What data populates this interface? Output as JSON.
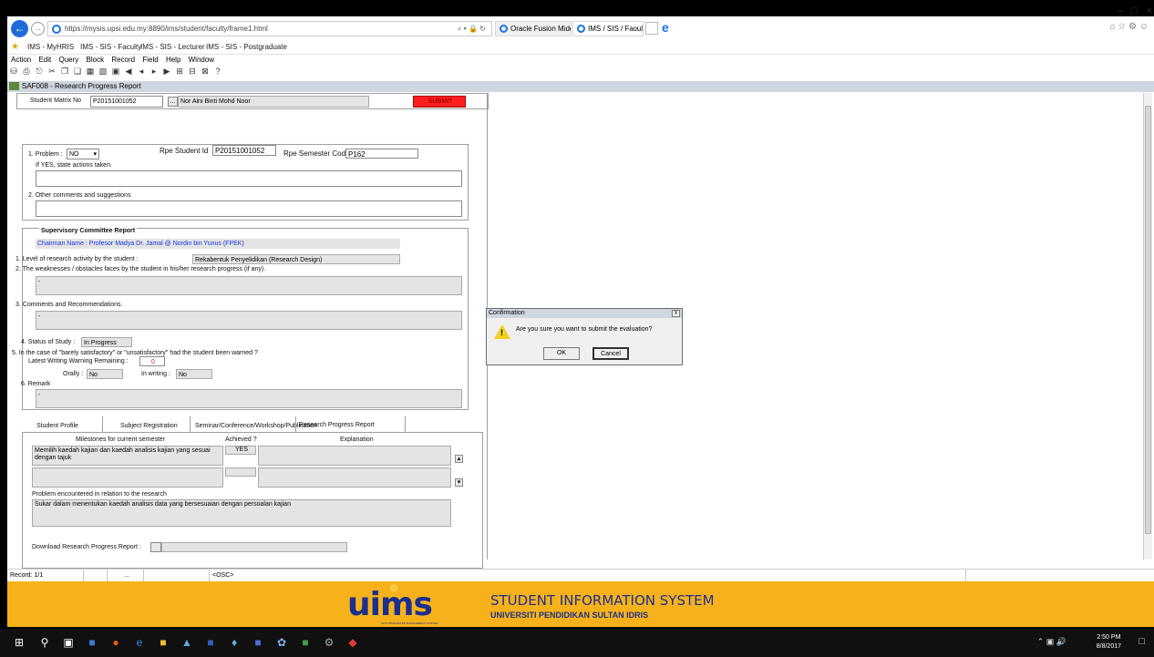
{
  "browser": {
    "url": "https://mysis.upsi.edu.my:8890/ims/student/faculty/frame1.html",
    "url_controls": "⌕ ▾ 🔒 ↻",
    "tabs": [
      {
        "label": "Oracle Fusion Middleware For..."
      },
      {
        "label": "IMS / SIS / Faculty"
      }
    ],
    "tab_close": "×",
    "favorites": [
      "IMS - MyHRIS",
      "IMS - SIS - Faculty",
      "IMS - SIS - Lecturer",
      "IMS - SIS - Postgraduate"
    ],
    "win_min": "–",
    "win_max": "□",
    "win_close": "×"
  },
  "menu": [
    "Action",
    "Edit",
    "Query",
    "Block",
    "Record",
    "Field",
    "Help",
    "Window"
  ],
  "form": {
    "title": "SAF008 - Research Progress Report",
    "student_matrix_label": "Student Matrix No",
    "student_matrix_value": "P20151001052",
    "student_name": "Nor Aini Binti Mohd Noor",
    "submit_label": "SUBMIT",
    "lov_button": "...",
    "problem_label": "1. Problem :",
    "problem_value": "NO",
    "rpe_student_id_label": "Rpe Student Id",
    "rpe_student_id_value": "P20151001052",
    "rpe_semester_label": "Rpe Semester Code",
    "rpe_semester_value": "P162",
    "if_yes_label": "If YES, state actions taken.",
    "other_comments_label": "2. Other comments and suggestions",
    "committee_title": "Supervisory Committee Report",
    "chairman": "Chairman Name : Profesor Madya Dr. Jamal @ Nordin bin Yunus  (FPEK)",
    "level_label": "1. Level of research activity by the student :",
    "level_value": "Rekabentuk Penyelidikan (Research Design)",
    "weakness_label": "2. The weaknesses / obstacles faces by the student in his/her research progress (if any).",
    "weakness_value": "-",
    "comments_label": "3. Comments and Recommendations.",
    "comments_value": "-",
    "status_label": "4. Status of Study :",
    "status_value": "In Progress",
    "warning_question": "5. In the case of \"barely satisfactory\" or \"unsatisfactory\" had the student been warned ?",
    "warning_remaining_label": "Latest Writing Warning Remaining :",
    "warning_remaining_value": "0",
    "orally_label": "Orally :",
    "orally_value": "No",
    "inwriting_label": "In writing :",
    "inwriting_value": "No",
    "remark_label": "6. Remark",
    "remark_value": "-",
    "tabs": [
      "Student Profile",
      "Subject Registration",
      "Seminar/Conference/Workshop/Publication",
      "Research Progress Report"
    ],
    "milestone_header": "Milestones for current semester",
    "achieved_header": "Achieved ?",
    "explanation_header": "Explanation",
    "milestone_1": "Memilih kaedah kajian dan kaedah analisis kajian yang sesuai dengan tajuk",
    "achieved_1": "YES",
    "problem_research_label": "Problem encountered in relation to the research",
    "problem_research_value": "Sukar dalam menentukan kaedah analisis data yang bersesuaian dengan persoalan kajian",
    "download_label": "Download Research Progress Report :"
  },
  "dialog": {
    "title": "Confirmation",
    "close_glyph": "x",
    "message": "Are you sure you want to submit the evaluation?",
    "ok": "OK",
    "cancel": "Cancel"
  },
  "status": {
    "record": "Record: 1/1",
    "dots": "...",
    "osc": "<OSC>"
  },
  "banner": {
    "logo": "uims",
    "logo_sub": "UPSI INTEGRATED MANAGEMENT SYSTEM",
    "title": "STUDENT INFORMATION SYSTEM",
    "subtitle": "UNIVERSITI PENDIDIKAN SULTAN IDRIS"
  },
  "taskbar": {
    "time": "2:50 PM",
    "date": "8/8/2017"
  }
}
